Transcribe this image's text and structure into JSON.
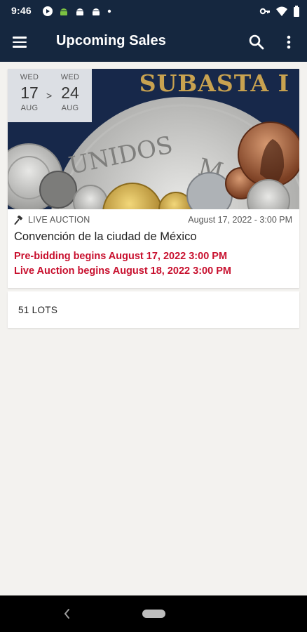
{
  "status_bar": {
    "time": "9:46",
    "left_icons": [
      "play-store-icon",
      "android-icon",
      "android-icon",
      "android-icon",
      "dot-icon"
    ],
    "right_icons": [
      "key-icon",
      "wifi-icon",
      "battery-icon"
    ]
  },
  "app_bar": {
    "title": "Upcoming Sales",
    "menu_icon": "hamburger-menu-icon",
    "search_icon": "search-icon",
    "more_icon": "more-vert-icon",
    "background": "#15273f"
  },
  "sale": {
    "banner_text": "SUBASTA I",
    "start": {
      "dow": "WED",
      "day": "17",
      "month": "AUG"
    },
    "separator": ">",
    "end": {
      "dow": "WED",
      "day": "24",
      "month": "AUG"
    },
    "type_icon": "gavel-icon",
    "type": "LIVE AUCTION",
    "date": "August 17, 2022 - 3:00 PM",
    "title": "Convención de la ciudad de México",
    "prebidding": "Pre-bidding begins August 17, 2022  3:00 PM",
    "live_begins": "Live Auction begins August 18, 2022  3:00 PM",
    "accent_color": "#c8102e"
  },
  "lots": {
    "label": "51 LOTS"
  },
  "nav": {
    "back_icon": "back-chevron-icon",
    "home_icon": "home-pill-icon"
  }
}
